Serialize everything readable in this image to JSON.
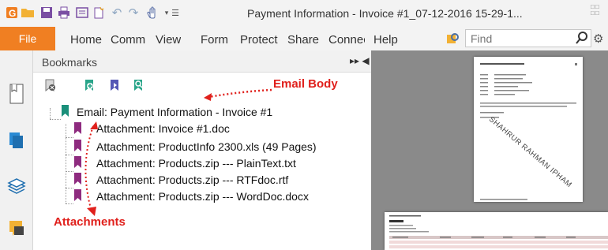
{
  "window": {
    "title": "Payment Information - Invoice #1_07-12-2016 15-29-1..."
  },
  "menu": {
    "items": [
      {
        "label": "File"
      },
      {
        "label": "Home"
      },
      {
        "label": "Comm"
      },
      {
        "label": "View"
      },
      {
        "label": "Form"
      },
      {
        "label": "Protect"
      },
      {
        "label": "Share"
      },
      {
        "label": "Connec"
      },
      {
        "label": "Help"
      }
    ],
    "find_placeholder": "Find"
  },
  "bookmarks": {
    "header": "Bookmarks",
    "items": [
      {
        "label": "Email: Payment Information - Invoice #1",
        "icon_color": "#1a8f7a"
      },
      {
        "label": "Attachment: Invoice #1.doc",
        "icon_color": "#8e2b7f"
      },
      {
        "label": "Attachment: ProductInfo 2300.xls (49 Pages)",
        "icon_color": "#8e2b7f"
      },
      {
        "label": "Attachment: Products.zip --- PlainText.txt",
        "icon_color": "#8e2b7f"
      },
      {
        "label": "Attachment: Products.zip --- RTFdoc.rtf",
        "icon_color": "#8e2b7f"
      },
      {
        "label": "Attachment: Products.zip --- WordDoc.docx",
        "icon_color": "#8e2b7f"
      }
    ]
  },
  "annotations": {
    "email_body": "Email Body",
    "attachments": "Attachments",
    "color": "#e0201c"
  },
  "document": {
    "watermark": "SHAHRUR RAHMAN IPHAM"
  },
  "colors": {
    "file_tab": "#f07f22",
    "doc_background": "#8a8a8a"
  }
}
